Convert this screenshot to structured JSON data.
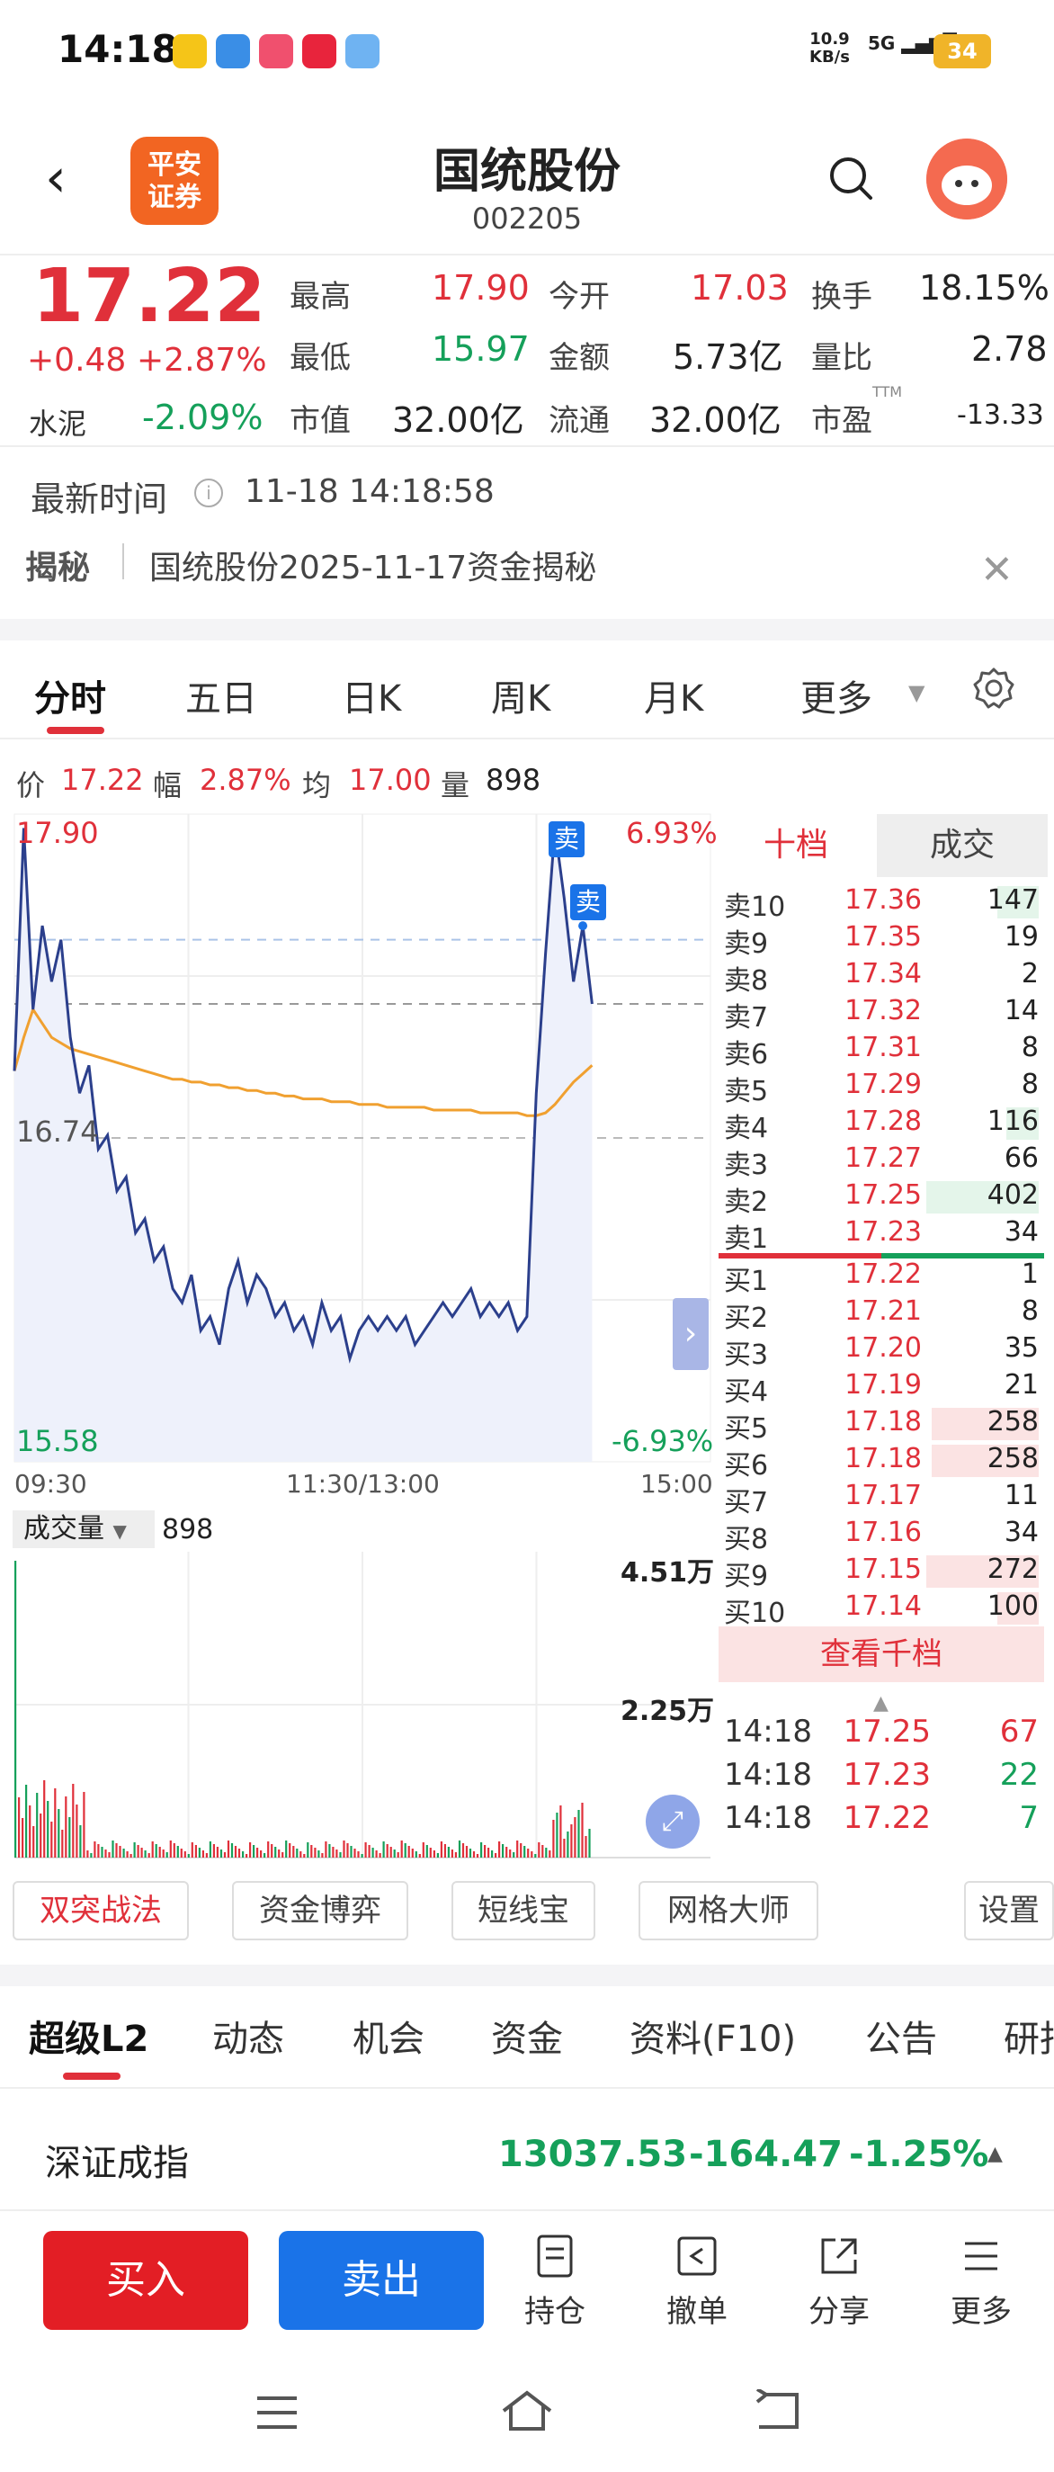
{
  "status": {
    "time": "14:18",
    "net_speed": "10.9",
    "net_unit": "KB/s",
    "signal": "5G",
    "battery": "34"
  },
  "header": {
    "logo_line1": "平安",
    "logo_line2": "证券",
    "name": "国统股份",
    "code": "002205"
  },
  "quote": {
    "price": "17.22",
    "change": "+0.48",
    "change_pct": "+2.87%",
    "sector_label": "水泥",
    "sector_pct": "-2.09%",
    "high_label": "最高",
    "high": "17.90",
    "open_label": "今开",
    "open": "17.03",
    "turnover_label": "换手",
    "turnover": "18.15%",
    "low_label": "最低",
    "low": "15.97",
    "amount_label": "金额",
    "amount": "5.73亿",
    "vol_ratio_label": "量比",
    "vol_ratio": "2.78",
    "mcap_label": "市值",
    "mcap": "32.00亿",
    "float_label": "流通",
    "float": "32.00亿",
    "pe_label": "市盈",
    "pe_sup": "TTM",
    "pe": "-13.33"
  },
  "latest": {
    "label": "最新时间",
    "value": "11-18 14:18:58"
  },
  "reveal": {
    "label": "揭秘",
    "text": "国统股份2025-11-17资金揭秘"
  },
  "tabs": [
    "分时",
    "五日",
    "日K",
    "周K",
    "月K",
    "更多"
  ],
  "info_bar": {
    "price_label": "价",
    "price": "17.22",
    "amp_label": "幅",
    "amp": "2.87%",
    "avg_label": "均",
    "avg": "17.00",
    "vol_label": "量",
    "vol": "898"
  },
  "chart_labels": {
    "top_price": "17.90",
    "top_pct": "6.93%",
    "mid_price": "16.74",
    "bottom_price": "15.58",
    "bottom_pct": "-6.93%",
    "t_start": "09:30",
    "t_mid": "11:30/13:00",
    "t_end": "15:00",
    "sell_tag": "卖",
    "vol_select": "成交量",
    "vol_value": "898",
    "vol_max": "4.51万",
    "vol_mid": "2.25万"
  },
  "chart_data": {
    "type": "line",
    "x_range": [
      "09:30",
      "15:00"
    ],
    "ylim": [
      15.58,
      17.9
    ],
    "y_pct_range": [
      "-6.93%",
      "6.93%"
    ],
    "reference_price": 16.74,
    "series": [
      {
        "color": "#2b3f8c",
        "values": [
          16.98,
          17.85,
          17.2,
          17.5,
          17.3,
          17.45,
          17.1,
          16.9,
          17.0,
          16.7,
          16.75,
          16.55,
          16.6,
          16.4,
          16.45,
          16.3,
          16.35,
          16.2,
          16.15,
          16.25,
          16.05,
          16.1,
          16.0,
          16.2,
          16.3,
          16.15,
          16.25,
          16.2,
          16.1,
          16.15,
          16.05,
          16.1,
          16.0,
          16.15,
          16.05,
          16.1,
          15.95,
          16.05,
          16.1,
          16.05,
          16.1,
          16.05,
          16.1,
          16.0,
          16.05,
          16.1,
          16.15,
          16.1,
          16.15,
          16.2,
          16.1,
          16.15,
          16.1,
          16.15,
          16.05,
          16.1,
          16.9,
          17.4,
          17.85,
          17.6,
          17.3,
          17.5,
          17.22
        ]
      },
      {
        "color": "#f0a030",
        "values": [
          16.98,
          17.1,
          17.2,
          17.15,
          17.1,
          17.08,
          17.06,
          17.05,
          17.04,
          17.03,
          17.02,
          17.01,
          17.0,
          16.99,
          16.98,
          16.97,
          16.96,
          16.95,
          16.95,
          16.94,
          16.94,
          16.93,
          16.93,
          16.92,
          16.92,
          16.91,
          16.91,
          16.9,
          16.9,
          16.89,
          16.89,
          16.88,
          16.88,
          16.88,
          16.87,
          16.87,
          16.87,
          16.86,
          16.86,
          16.86,
          16.85,
          16.85,
          16.85,
          16.85,
          16.85,
          16.84,
          16.84,
          16.84,
          16.84,
          16.84,
          16.83,
          16.83,
          16.83,
          16.83,
          16.83,
          16.82,
          16.82,
          16.83,
          16.86,
          16.9,
          16.94,
          16.97,
          17.0
        ]
      }
    ]
  },
  "orderbook": {
    "tab_active": "十档",
    "tab_other": "成交",
    "asks": [
      {
        "label": "卖10",
        "price": "17.36",
        "vol": "147",
        "bar": 0.37
      },
      {
        "label": "卖9",
        "price": "17.35",
        "vol": "19",
        "bar": 0
      },
      {
        "label": "卖8",
        "price": "17.34",
        "vol": "2",
        "bar": 0
      },
      {
        "label": "卖7",
        "price": "17.32",
        "vol": "14",
        "bar": 0
      },
      {
        "label": "卖6",
        "price": "17.31",
        "vol": "8",
        "bar": 0
      },
      {
        "label": "卖5",
        "price": "17.29",
        "vol": "8",
        "bar": 0
      },
      {
        "label": "卖4",
        "price": "17.28",
        "vol": "116",
        "bar": 0.29
      },
      {
        "label": "卖3",
        "price": "17.27",
        "vol": "66",
        "bar": 0
      },
      {
        "label": "卖2",
        "price": "17.25",
        "vol": "402",
        "bar": 1.0
      },
      {
        "label": "卖1",
        "price": "17.23",
        "vol": "34",
        "bar": 0
      }
    ],
    "bids": [
      {
        "label": "买1",
        "price": "17.22",
        "vol": "1",
        "bar": 0
      },
      {
        "label": "买2",
        "price": "17.21",
        "vol": "8",
        "bar": 0
      },
      {
        "label": "买3",
        "price": "17.20",
        "vol": "35",
        "bar": 0
      },
      {
        "label": "买4",
        "price": "17.19",
        "vol": "21",
        "bar": 0
      },
      {
        "label": "买5",
        "price": "17.18",
        "vol": "258",
        "bar": 0.95
      },
      {
        "label": "买6",
        "price": "17.18",
        "vol": "258",
        "bar": 0.95
      },
      {
        "label": "买7",
        "price": "17.17",
        "vol": "11",
        "bar": 0
      },
      {
        "label": "买8",
        "price": "17.16",
        "vol": "34",
        "bar": 0
      },
      {
        "label": "买9",
        "price": "17.15",
        "vol": "272",
        "bar": 1.0
      },
      {
        "label": "买10",
        "price": "17.14",
        "vol": "100",
        "bar": 0.37
      }
    ],
    "view_more": "查看千档",
    "trades": [
      {
        "time": "14:18",
        "price": "17.25",
        "vol": "67",
        "color": "#e0303a"
      },
      {
        "time": "14:18",
        "price": "17.23",
        "vol": "22",
        "color": "#15a05a"
      },
      {
        "time": "14:18",
        "price": "17.22",
        "vol": "7",
        "color": "#15a05a"
      }
    ]
  },
  "tools": [
    "双突战法",
    "资金博弈",
    "短线宝",
    "网格大师",
    "设置"
  ],
  "tabs2": [
    "超级L2",
    "动态",
    "机会",
    "资金",
    "资料(F10)",
    "公告",
    "研报"
  ],
  "index": {
    "name": "深证成指",
    "value": "13037.53",
    "change": "-164.47",
    "pct": "-1.25%"
  },
  "bottom": {
    "buy": "买入",
    "sell": "卖出",
    "hold": "持仓",
    "cancel": "撤单",
    "share": "分享",
    "more": "更多"
  },
  "colors": {
    "up": "#e0303a",
    "down": "#15a05a",
    "buy_btn": "#e31e25",
    "sell_btn": "#1a73e8"
  }
}
